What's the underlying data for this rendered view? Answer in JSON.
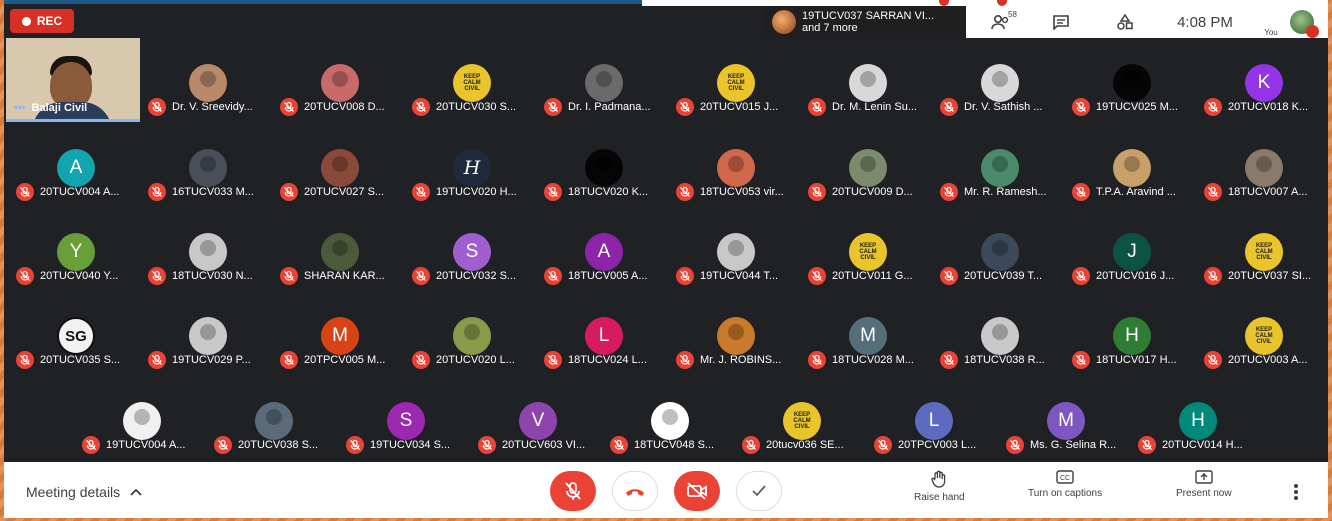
{
  "recording": {
    "label": "REC"
  },
  "presenter": {
    "name": "19TUCV037 SARRAN VI...",
    "more": "and 7 more"
  },
  "toolbar_top": {
    "people_count": "58",
    "time": "4:08 PM",
    "you_label": "You"
  },
  "self_tile": {
    "name": "Balaji Civil"
  },
  "participants": [
    {
      "name": "Dr. V. Sreevidy...",
      "avatar": "photo",
      "color": "#b98a6a"
    },
    {
      "name": "20TUCV008 D...",
      "avatar": "photo",
      "color": "#c96a6a"
    },
    {
      "name": "20TUCV030 S...",
      "avatar": "keep-calm",
      "color": "#e9c42a"
    },
    {
      "name": "Dr. I. Padmana...",
      "avatar": "photo",
      "color": "#6a6a6a"
    },
    {
      "name": "20TUCV015 J...",
      "avatar": "keep-calm",
      "color": "#e9c42a"
    },
    {
      "name": "Dr. M. Lenin Su...",
      "avatar": "photo",
      "color": "#d8d8d8"
    },
    {
      "name": "Dr. V. Sathish ...",
      "avatar": "photo",
      "color": "#d8d8d8"
    },
    {
      "name": "19TUCV025 M...",
      "avatar": "photo",
      "color": "#050505"
    },
    {
      "name": "20TUCV018 K...",
      "avatar": "K",
      "color": "#9334e6"
    },
    {
      "name": "20TUCV004 A...",
      "avatar": "A",
      "color": "#12a4af"
    },
    {
      "name": "16TUCV033 M...",
      "avatar": "photo",
      "color": "#4a4f5a"
    },
    {
      "name": "20TUCV027 S...",
      "avatar": "photo",
      "color": "#8a4a3a"
    },
    {
      "name": "19TUCV020 H...",
      "avatar": "H-script",
      "color": "#1f2a3c"
    },
    {
      "name": "18TUCV020 K...",
      "avatar": "photo",
      "color": "#050505"
    },
    {
      "name": "18TUCV053 vir...",
      "avatar": "photo",
      "color": "#d0674a"
    },
    {
      "name": "20TUCV009 D...",
      "avatar": "photo",
      "color": "#7a8a6a"
    },
    {
      "name": "Mr. R. Ramesh...",
      "avatar": "photo",
      "color": "#4a8a6a"
    },
    {
      "name": "T.P.A. Aravind ...",
      "avatar": "photo",
      "color": "#c9a06a"
    },
    {
      "name": "18TUCV007 A...",
      "avatar": "photo",
      "color": "#8a7a6a"
    },
    {
      "name": "20TUCV040 Y...",
      "avatar": "Y",
      "color": "#689f38"
    },
    {
      "name": "18TUCV030 N...",
      "avatar": "photo",
      "color": "#c8c8c8"
    },
    {
      "name": "SHARAN KAR...",
      "avatar": "photo",
      "color": "#4a5a3a"
    },
    {
      "name": "20TUCV032 S...",
      "avatar": "S",
      "color": "#9f5fd0"
    },
    {
      "name": "18TUCV005 A...",
      "avatar": "A",
      "color": "#8e24aa"
    },
    {
      "name": "19TUCV044 T...",
      "avatar": "photo",
      "color": "#c8c8c8"
    },
    {
      "name": "20TUCV011 G...",
      "avatar": "keep-calm",
      "color": "#e9c42a"
    },
    {
      "name": "20TUCV039 T...",
      "avatar": "photo",
      "color": "#3a4a5a"
    },
    {
      "name": "20TUCV016 J...",
      "avatar": "J",
      "color": "#0b5345"
    },
    {
      "name": "20TUCV037 SI...",
      "avatar": "keep-calm",
      "color": "#e9c42a"
    },
    {
      "name": "20TUCV035 S...",
      "avatar": "SG",
      "color": "#f2f2f2"
    },
    {
      "name": "19TUCV029 P...",
      "avatar": "photo",
      "color": "#c8c8c8"
    },
    {
      "name": "20TPCV005 M...",
      "avatar": "M",
      "color": "#d84315"
    },
    {
      "name": "20TUCV020 L...",
      "avatar": "photo",
      "color": "#8a9a4a"
    },
    {
      "name": "18TUCV024 L...",
      "avatar": "L",
      "color": "#d81b60"
    },
    {
      "name": "Mr. J. ROBINS...",
      "avatar": "photo",
      "color": "#c97a2a"
    },
    {
      "name": "18TUCV028 M...",
      "avatar": "M",
      "color": "#546e7a"
    },
    {
      "name": "18TUCV038 R...",
      "avatar": "photo",
      "color": "#c8c8c8"
    },
    {
      "name": "18TUCV017 H...",
      "avatar": "H",
      "color": "#2e7d32"
    },
    {
      "name": "20TUCV003 A...",
      "avatar": "keep-calm",
      "color": "#e9c42a"
    },
    {
      "name": "19TUCV004 A...",
      "avatar": "photo",
      "color": "#f0f0f0"
    },
    {
      "name": "20TUCV038 S...",
      "avatar": "photo",
      "color": "#5a6a7a"
    },
    {
      "name": "19TUCV034 S...",
      "avatar": "S",
      "color": "#9c27b0"
    },
    {
      "name": "20TUCV603 VI...",
      "avatar": "V",
      "color": "#8e44ad"
    },
    {
      "name": "18TUCV048 S...",
      "avatar": "photo",
      "color": "#ffffff"
    },
    {
      "name": "20tucv036 SE...",
      "avatar": "keep-calm",
      "color": "#e9c42a"
    },
    {
      "name": "20TPCV003 L...",
      "avatar": "L",
      "color": "#5c6bc0"
    },
    {
      "name": "Ms. G. Selina R...",
      "avatar": "M",
      "color": "#7e57c2"
    },
    {
      "name": "20TUCV014 H...",
      "avatar": "H",
      "color": "#00897b"
    }
  ],
  "bottom": {
    "meeting_details": "Meeting details",
    "raise_hand": "Raise hand",
    "captions": "Turn on captions",
    "present": "Present now"
  }
}
